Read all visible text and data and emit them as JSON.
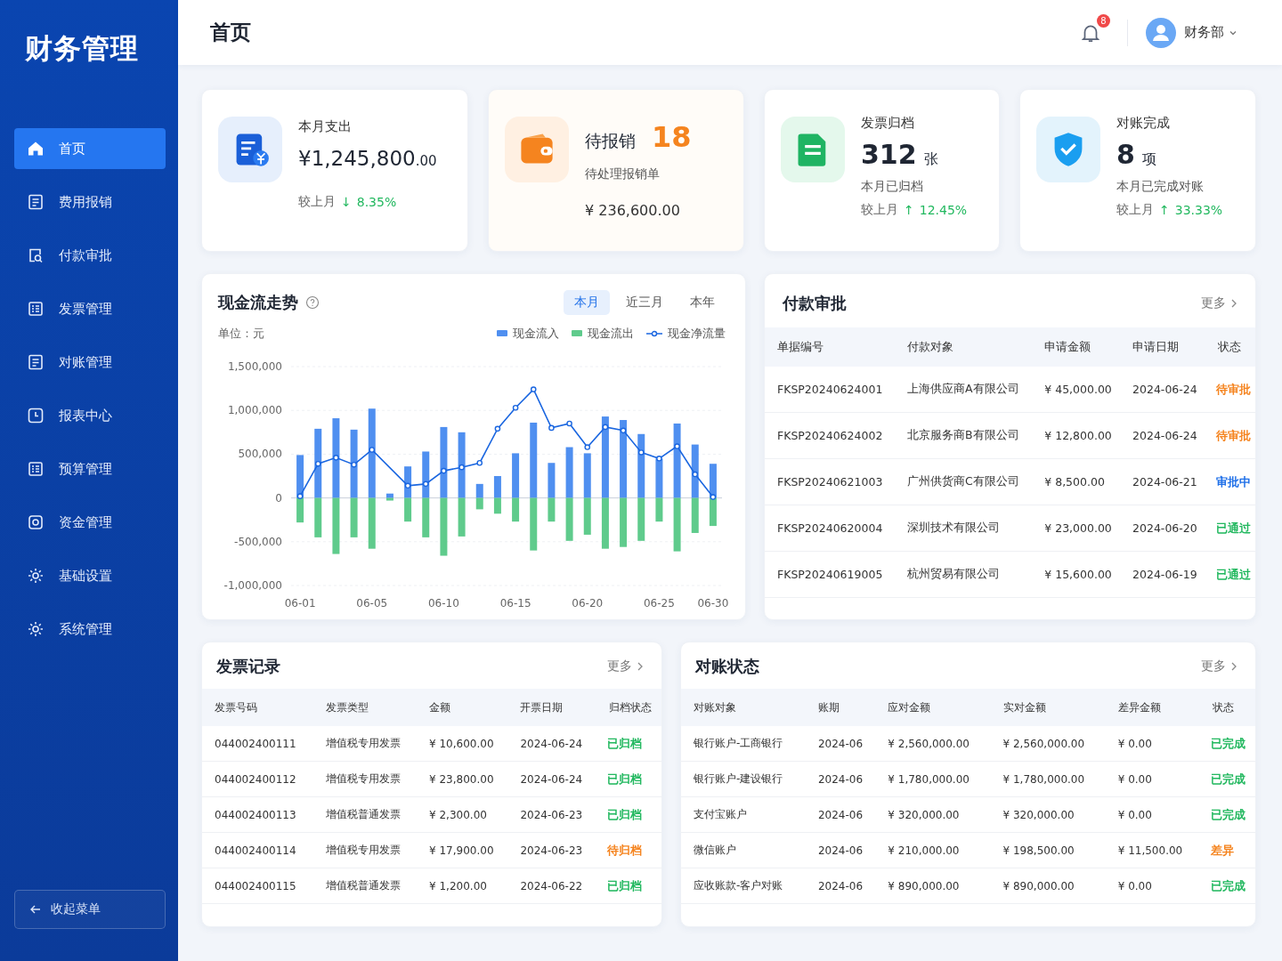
{
  "sidebar": {
    "title": "财务管理",
    "items": [
      {
        "label": "首页",
        "selected": true
      },
      {
        "label": "费用报销",
        "selected": false
      },
      {
        "label": "付款审批",
        "selected": false
      },
      {
        "label": "发票管理",
        "selected": false
      },
      {
        "label": "对账管理",
        "selected": false
      },
      {
        "label": "报表中心",
        "selected": false
      },
      {
        "label": "预算管理",
        "selected": false
      },
      {
        "label": "资金管理",
        "selected": false
      },
      {
        "label": "基础设置",
        "selected": false
      },
      {
        "label": "系统管理",
        "selected": false
      }
    ],
    "collapse": "收起菜单"
  },
  "header": {
    "title": "首页",
    "notifications": "8",
    "user": "财务部"
  },
  "cards": [
    {
      "kind": "amount",
      "label": "本月支出",
      "value": "¥1,245,800",
      "fraction": ".00",
      "compare_label": "较上月",
      "arrow": "↓",
      "change": "8.35%"
    },
    {
      "kind": "pending",
      "label": "待报销",
      "count": "18",
      "sub": "待处理报销单",
      "amount": "¥ 236,600.00"
    },
    {
      "kind": "count",
      "label": "发票归档",
      "value": "312",
      "unit": "张",
      "sub": "本月已归档",
      "compare_label": "较上月",
      "arrow": "↑",
      "change": "12.45%"
    },
    {
      "kind": "count",
      "label": "对账完成",
      "value": "8",
      "unit": "项",
      "sub": "本月已完成对账",
      "compare_label": "较上月",
      "arrow": "↑",
      "change": "33.33%"
    }
  ],
  "cashflow": {
    "title": "现金流走势",
    "tabs": [
      {
        "label": "本月",
        "selected": true
      },
      {
        "label": "近三月",
        "selected": false
      },
      {
        "label": "本年",
        "selected": false
      }
    ],
    "unit": "单位：元",
    "chart_data": {
      "type": "bar",
      "stacked": true,
      "grid": true,
      "categories": [
        "06-01",
        null,
        null,
        null,
        "06-05",
        null,
        null,
        null,
        "06-10",
        null,
        null,
        null,
        "06-15",
        null,
        null,
        null,
        "06-20",
        null,
        null,
        null,
        "06-25",
        null,
        null,
        "06-30"
      ],
      "ylim": [
        -1000000,
        1500000
      ],
      "yticks": [
        {
          "value": 1500000,
          "label": "1,500,000"
        },
        {
          "value": 1000000,
          "label": "1,000,000"
        },
        {
          "value": 500000,
          "label": "500,000"
        },
        {
          "value": 0,
          "label": "0"
        },
        {
          "value": -500000,
          "label": "-500,000"
        },
        {
          "value": -1000000,
          "label": "-1,000,000"
        }
      ],
      "series": [
        {
          "name": "现金流入",
          "type": "bar",
          "color": "#4f8ff0",
          "values": [
            490000,
            790000,
            910000,
            780000,
            1020000,
            50000,
            360000,
            530000,
            810000,
            750000,
            160000,
            250000,
            510000,
            860000,
            400000,
            580000,
            510000,
            930000,
            890000,
            730000,
            450000,
            850000,
            610000,
            390000
          ]
        },
        {
          "name": "现金流出",
          "type": "bar",
          "color": "#5fcb8c",
          "values": [
            -280000,
            -450000,
            -640000,
            -450000,
            -580000,
            -30000,
            -270000,
            -450000,
            -660000,
            -440000,
            -130000,
            -180000,
            -270000,
            -600000,
            -270000,
            -490000,
            -420000,
            -580000,
            -560000,
            -490000,
            -270000,
            -610000,
            -400000,
            -320000
          ]
        },
        {
          "name": "现金净流量",
          "type": "line",
          "marker": true,
          "color": "#1a66e0",
          "values": [
            20000,
            390000,
            460000,
            380000,
            550000,
            null,
            140000,
            160000,
            310000,
            350000,
            400000,
            790000,
            1030000,
            1240000,
            800000,
            850000,
            580000,
            810000,
            770000,
            520000,
            450000,
            590000,
            270000,
            10000
          ]
        }
      ]
    }
  },
  "payments": {
    "title": "付款审批",
    "more": "更多",
    "columns": [
      "单据编号",
      "付款对象",
      "申请金额",
      "申请日期",
      "状态"
    ],
    "rows": [
      {
        "cells": [
          "FKSP20240624001",
          "上海供应商A有限公司",
          "¥ 45,000.00",
          "2024-06-24",
          "待审批"
        ],
        "color": "#f5841f"
      },
      {
        "cells": [
          "FKSP20240624002",
          "北京服务商B有限公司",
          "¥ 12,800.00",
          "2024-06-24",
          "待审批"
        ],
        "color": "#f5841f"
      },
      {
        "cells": [
          "FKSP20240621003",
          "广州供货商C有限公司",
          "¥ 8,500.00",
          "2024-06-21",
          "审批中"
        ],
        "color": "#1e6fe8"
      },
      {
        "cells": [
          "FKSP20240620004",
          "深圳技术有限公司",
          "¥ 23,000.00",
          "2024-06-20",
          "已通过"
        ],
        "color": "#22b85f"
      },
      {
        "cells": [
          "FKSP20240619005",
          "杭州贸易有限公司",
          "¥ 15,600.00",
          "2024-06-19",
          "已通过"
        ],
        "color": "#22b85f"
      }
    ]
  },
  "invoices": {
    "title": "发票记录",
    "more": "更多",
    "columns": [
      "发票号码",
      "发票类型",
      "金额",
      "开票日期",
      "归档状态"
    ],
    "rows": [
      {
        "cells": [
          "044002400111",
          "增值税专用发票",
          "¥ 10,600.00",
          "2024-06-24",
          "已归档"
        ],
        "color": "#22b85f"
      },
      {
        "cells": [
          "044002400112",
          "增值税专用发票",
          "¥ 23,800.00",
          "2024-06-24",
          "已归档"
        ],
        "color": "#22b85f"
      },
      {
        "cells": [
          "044002400113",
          "增值税普通发票",
          "¥ 2,300.00",
          "2024-06-23",
          "已归档"
        ],
        "color": "#22b85f"
      },
      {
        "cells": [
          "044002400114",
          "增值税专用发票",
          "¥ 17,900.00",
          "2024-06-23",
          "待归档"
        ],
        "color": "#f5841f"
      },
      {
        "cells": [
          "044002400115",
          "增值税普通发票",
          "¥ 1,200.00",
          "2024-06-22",
          "已归档"
        ],
        "color": "#22b85f"
      }
    ]
  },
  "reconciliation": {
    "title": "对账状态",
    "more": "更多",
    "columns": [
      "对账对象",
      "账期",
      "应对金额",
      "实对金额",
      "差异金额",
      "状态"
    ],
    "rows": [
      {
        "cells": [
          "银行账户-工商银行",
          "2024-06",
          "¥ 2,560,000.00",
          "¥ 2,560,000.00",
          "¥ 0.00",
          "已完成"
        ],
        "color": "#22b85f"
      },
      {
        "cells": [
          "银行账户-建设银行",
          "2024-06",
          "¥ 1,780,000.00",
          "¥ 1,780,000.00",
          "¥ 0.00",
          "已完成"
        ],
        "color": "#22b85f"
      },
      {
        "cells": [
          "支付宝账户",
          "2024-06",
          "¥ 320,000.00",
          "¥ 320,000.00",
          "¥ 0.00",
          "已完成"
        ],
        "color": "#22b85f"
      },
      {
        "cells": [
          "微信账户",
          "2024-06",
          "¥ 210,000.00",
          "¥ 198,500.00",
          "¥ 11,500.00",
          "差异"
        ],
        "color": "#f5841f"
      },
      {
        "cells": [
          "应收账款-客户对账",
          "2024-06",
          "¥ 890,000.00",
          "¥ 890,000.00",
          "¥ 0.00",
          "已完成"
        ],
        "color": "#22b85f"
      }
    ]
  }
}
